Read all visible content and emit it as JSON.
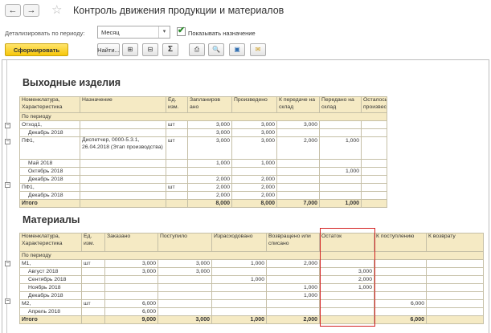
{
  "window": {
    "title": "Контроль движения продукции и материалов"
  },
  "nav": {
    "back": "←",
    "forward": "→",
    "favorite": "☆"
  },
  "filters": {
    "period_label": "Детализировать по периоду:",
    "period_value": "Месяц",
    "show_purpose_label": "Показывать назначение",
    "show_purpose_checked": true
  },
  "toolbar": {
    "generate": "Сформировать",
    "find": "Найти...",
    "sum": "Σ"
  },
  "products": {
    "title": "Выходные изделия",
    "headers": [
      "Номенклатура, Характеристика",
      "Назначение",
      "Ед. изм.",
      "Запланиров ано",
      "Произведено",
      "К передаче на склад",
      "Передано на склад",
      "Осталось произвести"
    ],
    "subheader": "По периоду",
    "rows": [
      {
        "name": "Отход1,",
        "purpose": "",
        "unit": "шт",
        "planned": "3,000",
        "produced": "3,000",
        "to_transfer": "3,000",
        "transferred": "",
        "remaining": ""
      },
      {
        "name": "Декабрь 2018",
        "purpose": "",
        "unit": "",
        "planned": "3,000",
        "produced": "3,000",
        "to_transfer": "",
        "transferred": "",
        "remaining": ""
      },
      {
        "name": "ПФ1,",
        "purpose": "Диспетчер, 0000-5.3.1, 26.04.2018 (Этап производства)",
        "unit": "шт",
        "planned": "3,000",
        "produced": "3,000",
        "to_transfer": "2,000",
        "transferred": "1,000",
        "remaining": ""
      },
      {
        "name": "Май 2018",
        "purpose": "",
        "unit": "",
        "planned": "1,000",
        "produced": "1,000",
        "to_transfer": "",
        "transferred": "",
        "remaining": ""
      },
      {
        "name": "Октябрь 2018",
        "purpose": "",
        "unit": "",
        "planned": "",
        "produced": "",
        "to_transfer": "",
        "transferred": "1,000",
        "remaining": ""
      },
      {
        "name": "Декабрь 2018",
        "purpose": "",
        "unit": "",
        "planned": "2,000",
        "produced": "2,000",
        "to_transfer": "",
        "transferred": "",
        "remaining": ""
      },
      {
        "name": "ПФ1,",
        "purpose": "",
        "unit": "шт",
        "planned": "2,000",
        "produced": "2,000",
        "to_transfer": "",
        "transferred": "",
        "remaining": ""
      },
      {
        "name": "Декабрь 2018",
        "purpose": "",
        "unit": "",
        "planned": "2,000",
        "produced": "2,000",
        "to_transfer": "",
        "transferred": "",
        "remaining": ""
      }
    ],
    "total": {
      "label": "Итого",
      "planned": "8,000",
      "produced": "8,000",
      "to_transfer": "7,000",
      "transferred": "1,000",
      "remaining": ""
    }
  },
  "materials": {
    "title": "Материалы",
    "headers": [
      "Номенклатура, Характеристика",
      "Ед. изм.",
      "Заказано",
      "Поступило",
      "Израсходовано",
      "Возвращено или списано",
      "Остаток",
      "К поступлению",
      "К возврату"
    ],
    "subheader": "По периоду",
    "rows": [
      {
        "name": "М1,",
        "unit": "шт",
        "ordered": "3,000",
        "received": "3,000",
        "consumed": "1,000",
        "returned": "2,000",
        "balance": "",
        "to_receive": "",
        "to_return": ""
      },
      {
        "name": "Август 2018",
        "unit": "",
        "ordered": "3,000",
        "received": "3,000",
        "consumed": "",
        "returned": "",
        "balance": "3,000",
        "to_receive": "",
        "to_return": ""
      },
      {
        "name": "Сентябрь 2018",
        "unit": "",
        "ordered": "",
        "received": "",
        "consumed": "1,000",
        "returned": "",
        "balance": "2,000",
        "to_receive": "",
        "to_return": ""
      },
      {
        "name": "Ноябрь 2018",
        "unit": "",
        "ordered": "",
        "received": "",
        "consumed": "",
        "returned": "1,000",
        "balance": "1,000",
        "to_receive": "",
        "to_return": ""
      },
      {
        "name": "Декабрь 2018",
        "unit": "",
        "ordered": "",
        "received": "",
        "consumed": "",
        "returned": "1,000",
        "balance": "",
        "to_receive": "",
        "to_return": ""
      },
      {
        "name": "М2,",
        "unit": "шт",
        "ordered": "6,000",
        "received": "",
        "consumed": "",
        "returned": "",
        "balance": "",
        "to_receive": "6,000",
        "to_return": ""
      },
      {
        "name": "Апрель 2018",
        "unit": "",
        "ordered": "6,000",
        "received": "",
        "consumed": "",
        "returned": "",
        "balance": "",
        "to_receive": "",
        "to_return": ""
      }
    ],
    "total": {
      "label": "Итого",
      "ordered": "9,000",
      "received": "3,000",
      "consumed": "1,000",
      "returned": "2,000",
      "balance": "",
      "to_receive": "6,000",
      "to_return": ""
    }
  },
  "colors": {
    "header_bg": "#f5eac4",
    "accent": "#f7c709",
    "highlight": "#d32020"
  }
}
